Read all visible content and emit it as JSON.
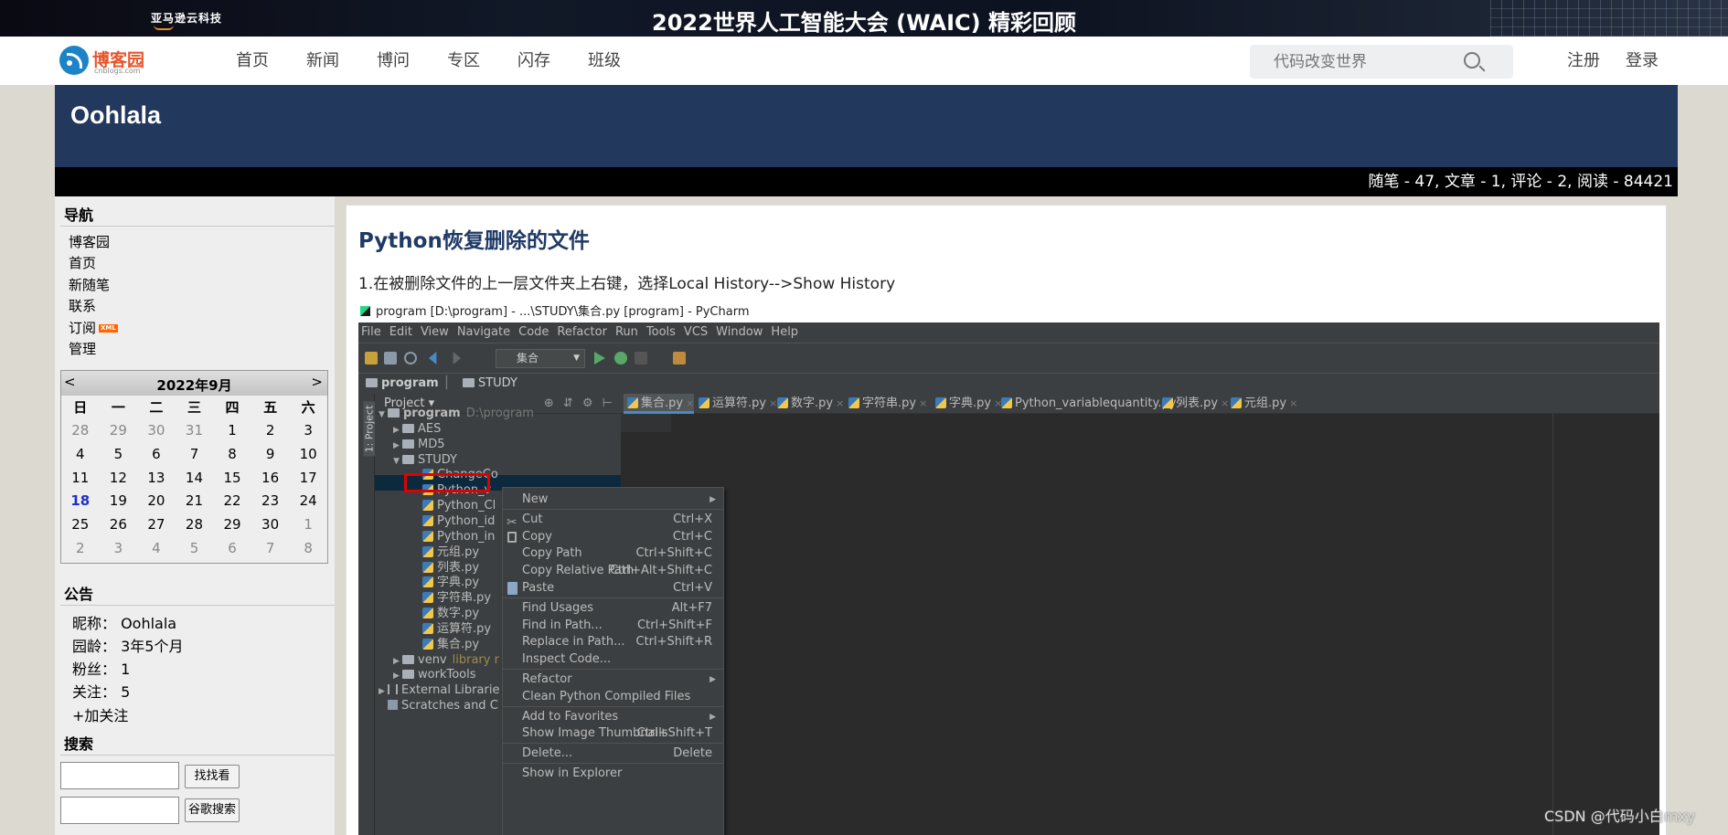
{
  "banner": {
    "brand": "亚马逊云科技",
    "title": "2022世界人工智能大会 (WAIC) 精彩回顾"
  },
  "site": {
    "logo_text": "博客园",
    "logo_sub": "cnblogs.com",
    "nav": [
      "首页",
      "新闻",
      "博问",
      "专区",
      "闪存",
      "班级"
    ],
    "search_placeholder": "代码改变世界",
    "register": "注册",
    "login": "登录"
  },
  "blog": {
    "name": "Oohlala",
    "stats": "随笔 - 47, 文章 - 1, 评论 - 2, 阅读 - 84421"
  },
  "sidebar": {
    "nav_title": "导航",
    "nav_items": [
      "博客园",
      "首页",
      "新随笔",
      "联系",
      "订阅",
      "管理"
    ],
    "xml_badge": "XML",
    "calendar": {
      "prev": "<",
      "next": ">",
      "title": "2022年9月",
      "weekdays": [
        "日",
        "一",
        "二",
        "三",
        "四",
        "五",
        "六"
      ],
      "days": [
        {
          "d": "28",
          "o": true
        },
        {
          "d": "29",
          "o": true
        },
        {
          "d": "30",
          "o": true
        },
        {
          "d": "31",
          "o": true
        },
        {
          "d": "1"
        },
        {
          "d": "2"
        },
        {
          "d": "3"
        },
        {
          "d": "4"
        },
        {
          "d": "5"
        },
        {
          "d": "6"
        },
        {
          "d": "7"
        },
        {
          "d": "8"
        },
        {
          "d": "9"
        },
        {
          "d": "10"
        },
        {
          "d": "11"
        },
        {
          "d": "12"
        },
        {
          "d": "13"
        },
        {
          "d": "14"
        },
        {
          "d": "15"
        },
        {
          "d": "16"
        },
        {
          "d": "17"
        },
        {
          "d": "18",
          "t": true
        },
        {
          "d": "19"
        },
        {
          "d": "20"
        },
        {
          "d": "21"
        },
        {
          "d": "22"
        },
        {
          "d": "23"
        },
        {
          "d": "24"
        },
        {
          "d": "25"
        },
        {
          "d": "26"
        },
        {
          "d": "27"
        },
        {
          "d": "28"
        },
        {
          "d": "29"
        },
        {
          "d": "30"
        },
        {
          "d": "1",
          "o": true
        },
        {
          "d": "2",
          "o": true
        },
        {
          "d": "3",
          "o": true
        },
        {
          "d": "4",
          "o": true
        },
        {
          "d": "5",
          "o": true
        },
        {
          "d": "6",
          "o": true
        },
        {
          "d": "7",
          "o": true
        },
        {
          "d": "8",
          "o": true
        }
      ]
    },
    "notice_title": "公告",
    "notice": [
      "昵称： Oohlala",
      "园龄： 3年5个月",
      "粉丝： 1",
      "关注： 5"
    ],
    "follow": "+加关注",
    "search_title": "搜索",
    "search_button": "找找看",
    "google_button": "谷歌搜索"
  },
  "post": {
    "title": "Python恢复删除的文件",
    "step1": "1.在被删除文件的上一层文件夹上右键，选择Local History-->Show History"
  },
  "pycharm": {
    "window_title": "program [D:\\program] - ...\\STUDY\\集合.py [program] - PyCharm",
    "menu": [
      "File",
      "Edit",
      "View",
      "Navigate",
      "Code",
      "Refactor",
      "Run",
      "Tools",
      "VCS",
      "Window",
      "Help"
    ],
    "run_config": "集合",
    "breadcrumb": [
      "program",
      "STUDY"
    ],
    "side_label": "1: Project",
    "project_header": "Project ▾",
    "tree": [
      {
        "label": "program",
        "extra": "D:\\program",
        "arrow": "▼",
        "kind": "folder",
        "indent": 0
      },
      {
        "label": "AES",
        "arrow": "▶",
        "kind": "folder",
        "indent": 1
      },
      {
        "label": "MD5",
        "arrow": "▶",
        "kind": "folder",
        "indent": 1
      },
      {
        "label": "STUDY",
        "arrow": "▼",
        "kind": "folder",
        "indent": 1
      },
      {
        "label": "ChangeCo",
        "kind": "py",
        "indent": 2
      },
      {
        "label": "Python_v",
        "kind": "py",
        "indent": 2
      },
      {
        "label": "Python_Cl",
        "kind": "py",
        "indent": 2
      },
      {
        "label": "Python_id",
        "kind": "py",
        "indent": 2
      },
      {
        "label": "Python_in",
        "kind": "py",
        "indent": 2
      },
      {
        "label": "元组.py",
        "kind": "py",
        "indent": 2
      },
      {
        "label": "列表.py",
        "kind": "py",
        "indent": 2
      },
      {
        "label": "字典.py",
        "kind": "py",
        "indent": 2
      },
      {
        "label": "字符串.py",
        "kind": "py",
        "indent": 2
      },
      {
        "label": "数字.py",
        "kind": "py",
        "indent": 2
      },
      {
        "label": "运算符.py",
        "kind": "py",
        "indent": 2
      },
      {
        "label": "集合.py",
        "kind": "py",
        "indent": 2
      },
      {
        "label": "venv",
        "extra": "library r",
        "arrow": "▶",
        "kind": "folder",
        "indent": 1
      },
      {
        "label": "workTools",
        "arrow": "▶",
        "kind": "folder",
        "indent": 1
      },
      {
        "label": "External Librarie",
        "arrow": "▶",
        "kind": "lib",
        "indent": 0
      },
      {
        "label": "Scratches and C",
        "kind": "scratch",
        "indent": 0
      }
    ],
    "tabs": [
      "集合.py",
      "运算符.py",
      "数字.py",
      "字符串.py",
      "字典.py",
      "Python_variablequantity.py",
      "列表.py",
      "元组.py"
    ],
    "context_menu": [
      {
        "label": "New",
        "submenu": true
      },
      {
        "sep": true
      },
      {
        "label": "Cut",
        "shortcut": "Ctrl+X",
        "icon": "cut"
      },
      {
        "label": "Copy",
        "shortcut": "Ctrl+C",
        "icon": "copy"
      },
      {
        "label": "Copy Path",
        "shortcut": "Ctrl+Shift+C"
      },
      {
        "label": "Copy Relative Path",
        "shortcut": "Ctrl+Alt+Shift+C"
      },
      {
        "label": "Paste",
        "shortcut": "Ctrl+V",
        "icon": "paste"
      },
      {
        "sep": true
      },
      {
        "label": "Find Usages",
        "shortcut": "Alt+F7"
      },
      {
        "label": "Find in Path...",
        "shortcut": "Ctrl+Shift+F"
      },
      {
        "label": "Replace in Path...",
        "shortcut": "Ctrl+Shift+R"
      },
      {
        "label": "Inspect Code..."
      },
      {
        "sep": true
      },
      {
        "label": "Refactor",
        "submenu": true
      },
      {
        "label": "Clean Python Compiled Files"
      },
      {
        "sep": true
      },
      {
        "label": "Add to Favorites",
        "submenu": true
      },
      {
        "label": "Show Image Thumbnails",
        "shortcut": "Ctrl+Shift+T"
      },
      {
        "sep": true
      },
      {
        "label": "Delete...",
        "shortcut": "Delete"
      },
      {
        "sep": true
      },
      {
        "label": "Show in Explorer"
      }
    ]
  },
  "watermark": "CSDN @代码小白mxy"
}
